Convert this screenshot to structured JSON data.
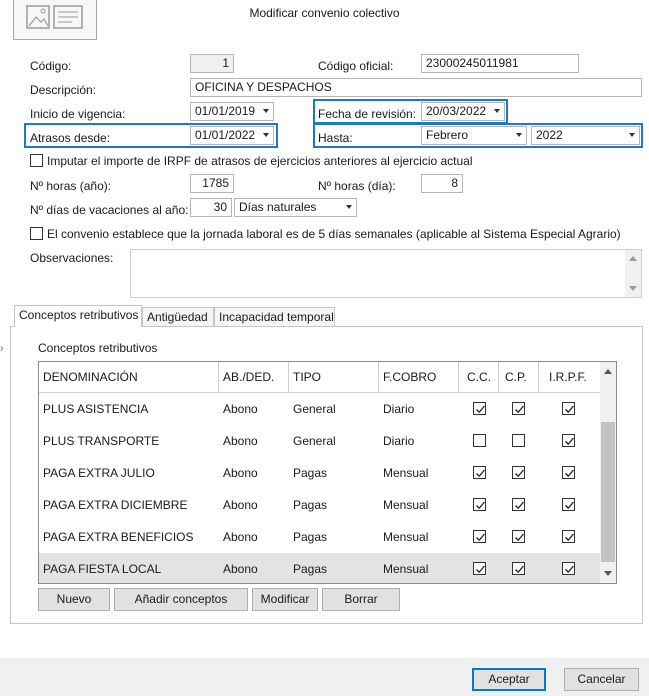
{
  "window": {
    "title": "Modificar convenio colectivo"
  },
  "form": {
    "codigo_label": "Código:",
    "codigo_value": "1",
    "codigo_oficial_label": "Código oficial:",
    "codigo_oficial_value": "23000245011981",
    "descripcion_label": "Descripción:",
    "descripcion_value": "OFICINA Y DESPACHOS",
    "inicio_label": "Inicio de vigencia:",
    "inicio_value": "01/01/2019",
    "revision_label": "Fecha de revisión:",
    "revision_value": "20/03/2022",
    "atrasos_label": "Atrasos desde:",
    "atrasos_value": "01/01/2022",
    "hasta_label": "Hasta:",
    "hasta_mes_value": "Febrero",
    "hasta_anio_value": "2022",
    "imputar_label": "Imputar el importe de IRPF de atrasos de ejercicios anteriores al ejercicio actual",
    "horas_anio_label": "Nº horas (año):",
    "horas_anio_value": "1785",
    "horas_dia_label": "Nº horas (día):",
    "horas_dia_value": "8",
    "vacaciones_label": "Nº días de vacaciones al año:",
    "vacaciones_value": "30",
    "vacaciones_tipo_value": "Días naturales",
    "jornada_label": "El convenio establece que la jornada laboral es de 5 días semanales (aplicable al Sistema Especial Agrario)",
    "observaciones_label": "Observaciones:"
  },
  "tabs": [
    {
      "label": "Conceptos retributivos"
    },
    {
      "label": "Antigüedad"
    },
    {
      "label": "Incapacidad temporal"
    }
  ],
  "grid": {
    "title": "Conceptos retributivos",
    "columns": [
      "DENOMINACIÓN",
      "AB./DED.",
      "TIPO",
      "F.COBRO",
      "C.C.",
      "C.P.",
      "I.R.P.F."
    ],
    "rows": [
      {
        "denominacion": "PLUS ASISTENCIA",
        "ab": "Abono",
        "tipo": "General",
        "cobro": "Diario",
        "cc": true,
        "cp": true,
        "irpf": true
      },
      {
        "denominacion": "PLUS TRANSPORTE",
        "ab": "Abono",
        "tipo": "General",
        "cobro": "Diario",
        "cc": false,
        "cp": false,
        "irpf": true
      },
      {
        "denominacion": "PAGA EXTRA JULIO",
        "ab": "Abono",
        "tipo": "Pagas",
        "cobro": "Mensual",
        "cc": true,
        "cp": true,
        "irpf": true
      },
      {
        "denominacion": "PAGA EXTRA DICIEMBRE",
        "ab": "Abono",
        "tipo": "Pagas",
        "cobro": "Mensual",
        "cc": true,
        "cp": true,
        "irpf": true
      },
      {
        "denominacion": "PAGA EXTRA BENEFICIOS",
        "ab": "Abono",
        "tipo": "Pagas",
        "cobro": "Mensual",
        "cc": true,
        "cp": true,
        "irpf": true
      },
      {
        "denominacion": "PAGA FIESTA LOCAL",
        "ab": "Abono",
        "tipo": "Pagas",
        "cobro": "Mensual",
        "cc": true,
        "cp": true,
        "irpf": true
      }
    ],
    "selected_row": 5
  },
  "grid_buttons": {
    "nuevo": "Nuevo",
    "anadir": "Añadir conceptos",
    "modificar": "Modificar",
    "borrar": "Borrar"
  },
  "footer": {
    "aceptar": "Aceptar",
    "cancelar": "Cancelar"
  },
  "colors": {
    "highlight": "#1e78c8",
    "selected_row": "#e3e3e3",
    "footer_bg": "#f0f0f0"
  }
}
